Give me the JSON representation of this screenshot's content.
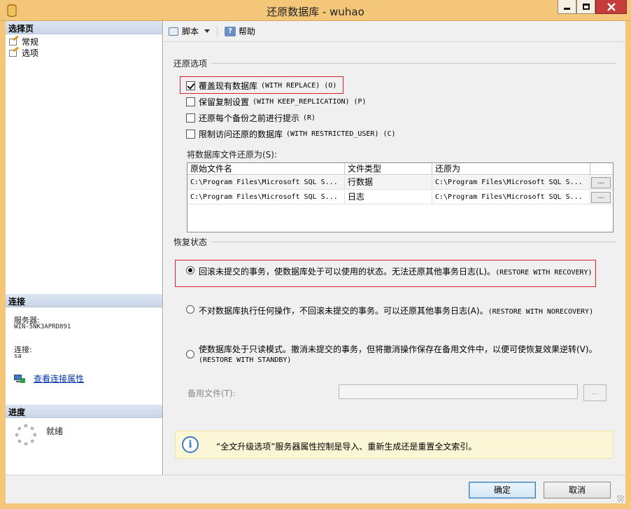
{
  "window": {
    "title": "还原数据库 - wuhao"
  },
  "left": {
    "select_page_header": "选择页",
    "nav_items": [
      "常规",
      "选项"
    ],
    "connection_header": "连接",
    "server_label": "服务器:",
    "server_value": "WIN-5NK3APRD891",
    "connection_label": "连接:",
    "connection_value": "sa",
    "view_connection_link": "查看连接属性",
    "progress_header": "进度",
    "progress_status": "就绪"
  },
  "toolbar": {
    "script_label": "脚本",
    "help_label": "帮助"
  },
  "restore_options": {
    "group_title": "还原选项",
    "options": [
      {
        "label": "覆盖现有数据库",
        "suffix": "(WITH REPLACE) (O)",
        "checked": true
      },
      {
        "label": "保留复制设置",
        "suffix": "(WITH KEEP_REPLICATION) (P)",
        "checked": false
      },
      {
        "label": "还原每个备份之前进行提示",
        "suffix": "(R)",
        "checked": false
      },
      {
        "label": "限制访问还原的数据库",
        "suffix": "(WITH RESTRICTED_USER) (C)",
        "checked": false
      }
    ],
    "restore_files_label": "将数据库文件还原为(S):"
  },
  "file_table": {
    "columns": [
      "原始文件名",
      "文件类型",
      "还原为"
    ],
    "rows": [
      {
        "original": "C:\\Program Files\\Microsoft SQL S...",
        "type": "行数据",
        "restore_as": "C:\\Program Files\\Microsoft SQL S...",
        "button": "..."
      },
      {
        "original": "C:\\Program Files\\Microsoft SQL S...",
        "type": "日志",
        "restore_as": "C:\\Program Files\\Microsoft SQL S...",
        "button": "..."
      }
    ]
  },
  "recovery_state": {
    "group_title": "恢复状态",
    "options": [
      {
        "label": "回滚未提交的事务，使数据库处于可以使用的状态。无法还原其他事务日志(L)。",
        "suffix": "(RESTORE WITH RECOVERY)",
        "selected": true
      },
      {
        "label": "不对数据库执行任何操作，不回滚未提交的事务。可以还原其他事务日志(A)。",
        "suffix": "(RESTORE WITH NORECOVERY)",
        "selected": false
      },
      {
        "label": "使数据库处于只读模式。撤消未提交的事务，但将撤消操作保存在备用文件中，以便可使恢复效果逆转(V)。",
        "suffix": "(RESTORE WITH STANDBY)",
        "selected": false
      }
    ],
    "standby_file_label": "备用文件(T):",
    "standby_file_value": "",
    "standby_browse": "..."
  },
  "info": {
    "icon": "info-icon",
    "text": "“全文升级选项”服务器属性控制是导入、重新生成还是重置全文索引。"
  },
  "buttons": {
    "ok": "确定",
    "cancel": "取消"
  }
}
